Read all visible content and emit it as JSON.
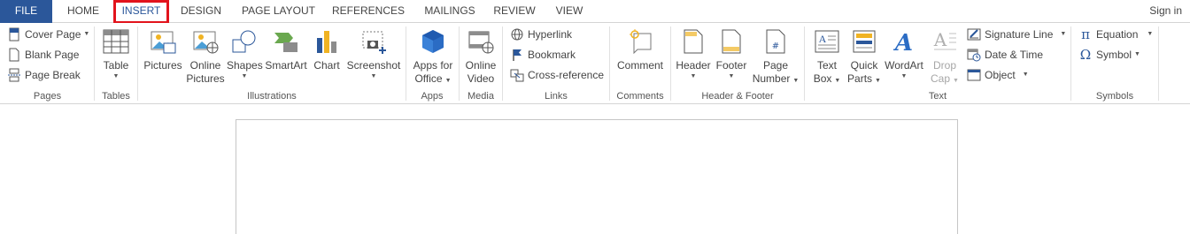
{
  "tabs": {
    "file": "FILE",
    "home": "HOME",
    "insert": "INSERT",
    "design": "DESIGN",
    "page_layout": "PAGE LAYOUT",
    "references": "REFERENCES",
    "mailings": "MAILINGS",
    "review": "REVIEW",
    "view": "VIEW",
    "sign_in": "Sign in"
  },
  "colors": {
    "file_tab": "#2b579a",
    "highlight": "#e2131c",
    "accent": "#2b579a"
  },
  "groups": {
    "pages": {
      "label": "Pages",
      "cover_page": "Cover Page",
      "blank_page": "Blank Page",
      "page_break": "Page Break"
    },
    "tables": {
      "label": "Tables",
      "table": "Table"
    },
    "illustrations": {
      "label": "Illustrations",
      "pictures": "Pictures",
      "online_pictures_1": "Online",
      "online_pictures_2": "Pictures",
      "shapes": "Shapes",
      "smartart": "SmartArt",
      "chart": "Chart",
      "screenshot": "Screenshot"
    },
    "apps": {
      "label": "Apps",
      "apps_1": "Apps for",
      "apps_2": "Office"
    },
    "media": {
      "label": "Media",
      "video_1": "Online",
      "video_2": "Video"
    },
    "links": {
      "label": "Links",
      "hyperlink": "Hyperlink",
      "bookmark": "Bookmark",
      "cross_reference": "Cross-reference"
    },
    "comments": {
      "label": "Comments",
      "comment": "Comment"
    },
    "header_footer": {
      "label": "Header & Footer",
      "header": "Header",
      "footer": "Footer",
      "page_number_1": "Page",
      "page_number_2": "Number"
    },
    "text": {
      "label": "Text",
      "text_box_1": "Text",
      "text_box_2": "Box",
      "quick_parts_1": "Quick",
      "quick_parts_2": "Parts",
      "wordart": "WordArt",
      "drop_cap_1": "Drop",
      "drop_cap_2": "Cap",
      "signature_line": "Signature Line",
      "date_time": "Date & Time",
      "object": "Object"
    },
    "symbols": {
      "label": "Symbols",
      "equation": "Equation",
      "symbol": "Symbol"
    }
  }
}
